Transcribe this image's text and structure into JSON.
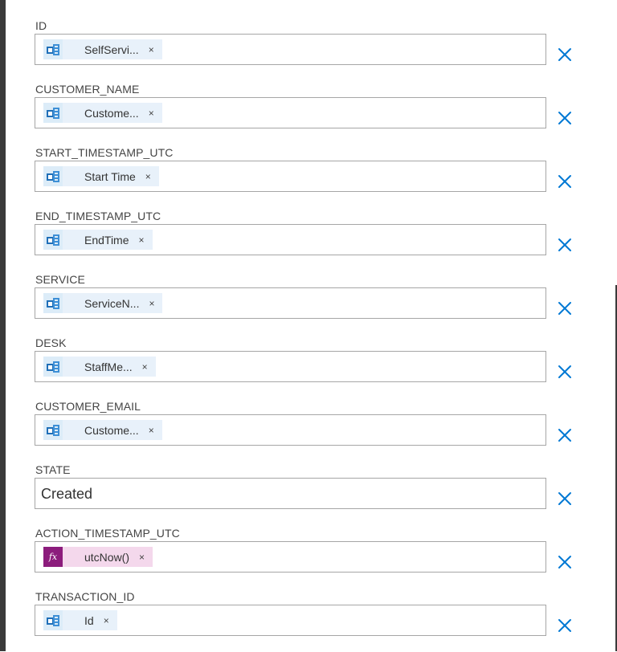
{
  "fields": [
    {
      "label": "ID",
      "token": {
        "kind": "excel",
        "icon": "excel-icon",
        "text": "SelfServi..."
      }
    },
    {
      "label": "CUSTOMER_NAME",
      "token": {
        "kind": "excel",
        "icon": "excel-icon",
        "text": "Custome..."
      }
    },
    {
      "label": "START_TIMESTAMP_UTC",
      "token": {
        "kind": "excel",
        "icon": "excel-icon",
        "text": "Start Time"
      }
    },
    {
      "label": "END_TIMESTAMP_UTC",
      "token": {
        "kind": "excel",
        "icon": "excel-icon",
        "text": "EndTime"
      }
    },
    {
      "label": "SERVICE",
      "token": {
        "kind": "excel",
        "icon": "excel-icon",
        "text": "ServiceN..."
      }
    },
    {
      "label": "DESK",
      "token": {
        "kind": "excel",
        "icon": "excel-icon",
        "text": "StaffMe..."
      }
    },
    {
      "label": "CUSTOMER_EMAIL",
      "token": {
        "kind": "excel",
        "icon": "excel-icon",
        "text": "Custome..."
      }
    },
    {
      "label": "STATE",
      "value": "Created"
    },
    {
      "label": "ACTION_TIMESTAMP_UTC",
      "token": {
        "kind": "fx",
        "icon": "function-icon",
        "icon_text": "fx",
        "text": "utcNow()"
      }
    },
    {
      "label": "TRANSACTION_ID",
      "token": {
        "kind": "excel",
        "icon": "excel-icon",
        "text": "Id"
      }
    }
  ],
  "token_remove_glyph": "×",
  "colors": {
    "accent": "#0078d4",
    "excel_token_bg": "#e8f1fa",
    "fx_token_bg": "#f4d8ec",
    "fx_icon_bg": "#8c1c7c",
    "delete_icon": "#0078d4"
  }
}
